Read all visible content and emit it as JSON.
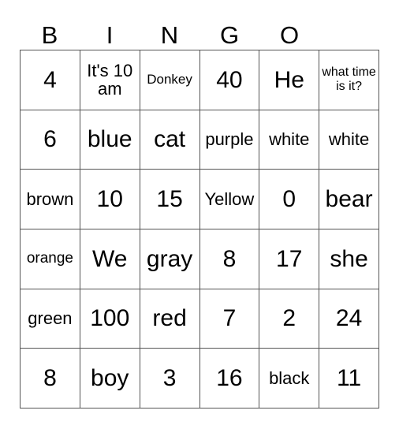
{
  "header": [
    "B",
    "I",
    "N",
    "G",
    "O"
  ],
  "cells": [
    [
      "4",
      "It's 10 am",
      "Donkey",
      "40",
      "He",
      "what time is it?"
    ],
    [
      "6",
      "blue",
      "cat",
      "purple",
      "white",
      "white"
    ],
    [
      "brown",
      "10",
      "15",
      "Yellow",
      "0",
      "bear"
    ],
    [
      "orange",
      "We",
      "gray",
      "8",
      "17",
      "she"
    ],
    [
      "green",
      "100",
      "red",
      "7",
      "2",
      "24"
    ],
    [
      "8",
      "boy",
      "3",
      "16",
      "black",
      "11"
    ]
  ]
}
